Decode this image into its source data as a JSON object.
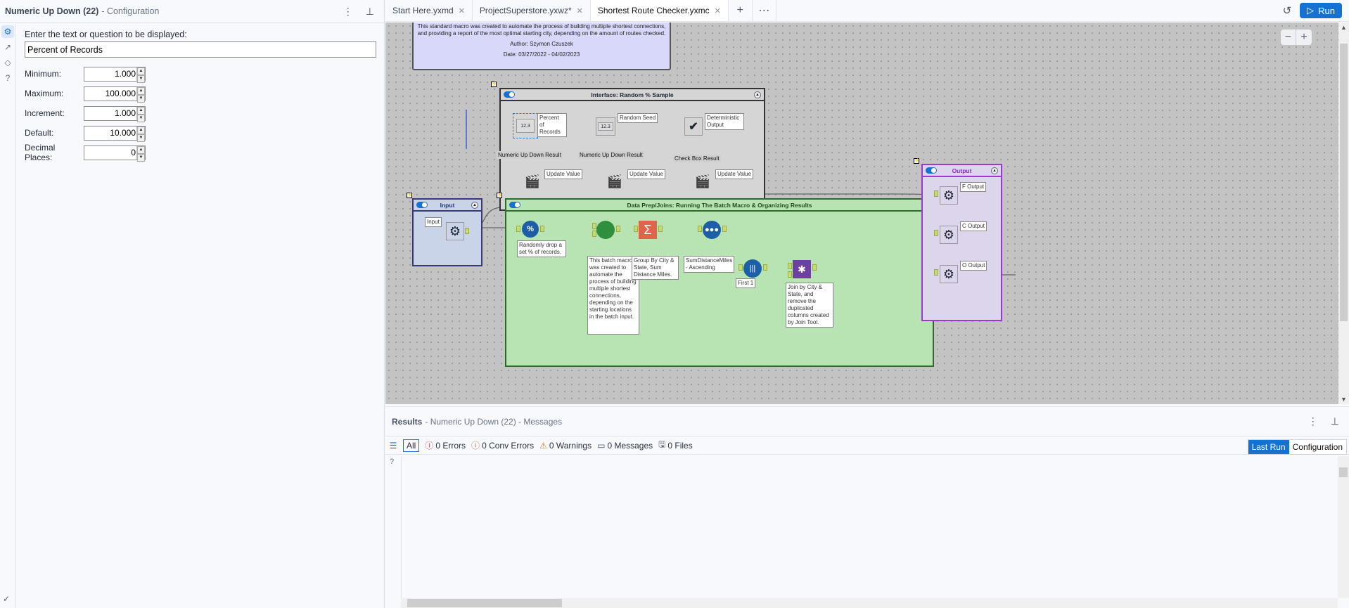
{
  "config_panel": {
    "title": "Numeric Up Down (22)",
    "subtitle": "- Configuration",
    "rail_icons": [
      "gear-icon",
      "link-icon",
      "tag-icon",
      "help-icon"
    ],
    "prompt_label": "Enter the text or question to be displayed:",
    "prompt_value": "Percent of Records",
    "fields": [
      {
        "label": "Minimum:",
        "value": "1.000"
      },
      {
        "label": "Maximum:",
        "value": "100.000"
      },
      {
        "label": "Increment:",
        "value": "1.000"
      },
      {
        "label": "Default:",
        "value": "10.000"
      },
      {
        "label": "Decimal Places:",
        "value": "0"
      }
    ]
  },
  "tabs": [
    {
      "label": "Start Here.yxmd",
      "active": false
    },
    {
      "label": "ProjectSuperstore.yxwz*",
      "active": false
    },
    {
      "label": "Shortest Route Checker.yxmc",
      "active": true
    }
  ],
  "toolbar": {
    "run_label": "Run"
  },
  "canvas": {
    "comment": {
      "line1": "This standard macro was created to automate the process of building multiple shortest connections,",
      "line2": "and providing a report of the most optimal starting city, depending on the amount of routes checked.",
      "author": "Author: Szymon Czuszek",
      "date": "Date: 03/27/2022 - 04/02/2023"
    },
    "interface_container": {
      "title": "Interface: Random % Sample",
      "tools": [
        {
          "label": "Percent of Records",
          "connection": "Numeric Up Down Result",
          "action_label": "Update Value"
        },
        {
          "label": "Random Seed",
          "connection": "Numeric Up Down Result",
          "action_label": "Update Value"
        },
        {
          "label": "Deterministic Output",
          "connection": "Check Box Result",
          "action_label": "Update Value"
        }
      ],
      "numeric_glyph": "12.3"
    },
    "input_container": {
      "title": "Input",
      "tool_label": "Input"
    },
    "dataprep_container": {
      "title": "Data Prep/Joins: Running The Batch Macro & Organizing Results",
      "annotations": {
        "sample": "Randomly drop a set % of records.",
        "batch": "This batch macro was created to automate the process of building multiple shortest connections, depending on the starting locations in the batch input.",
        "summarize": "Group By City & State, Sum Distance Miles.",
        "sort": "SumDistanceMiles - Ascending",
        "sample2": "First 1",
        "join": "Join by City & State, and remove the duplicated columns created by Join Tool."
      }
    },
    "output_container": {
      "title": "Output",
      "outputs": [
        "F Output",
        "C Output",
        "O Output"
      ]
    }
  },
  "results_panel": {
    "title": "Results",
    "subtitle": "- Numeric Up Down (22) - Messages",
    "filters": [
      {
        "label": "All",
        "icon": "list-icon"
      },
      {
        "label": "0 Errors",
        "icon": "error-icon"
      },
      {
        "label": "0 Conv Errors",
        "icon": "conv-error-icon"
      },
      {
        "label": "0 Warnings",
        "icon": "warning-icon"
      },
      {
        "label": "0 Messages",
        "icon": "message-icon"
      },
      {
        "label": "0 Files",
        "icon": "file-icon"
      }
    ],
    "view_toggle": {
      "active": "Last Run",
      "inactive": "Configuration"
    }
  },
  "colors": {
    "accent": "#1672d2",
    "canvas_bg": "#c3c3c3",
    "comment_bg": "#d8d8fa",
    "interface_bg": "#d5d5d5",
    "input_bg": "#c9d4e8",
    "dataprep_bg": "#b8e3b3",
    "output_bg": "#ddd5ec",
    "output_border": "#9a3bd0"
  }
}
